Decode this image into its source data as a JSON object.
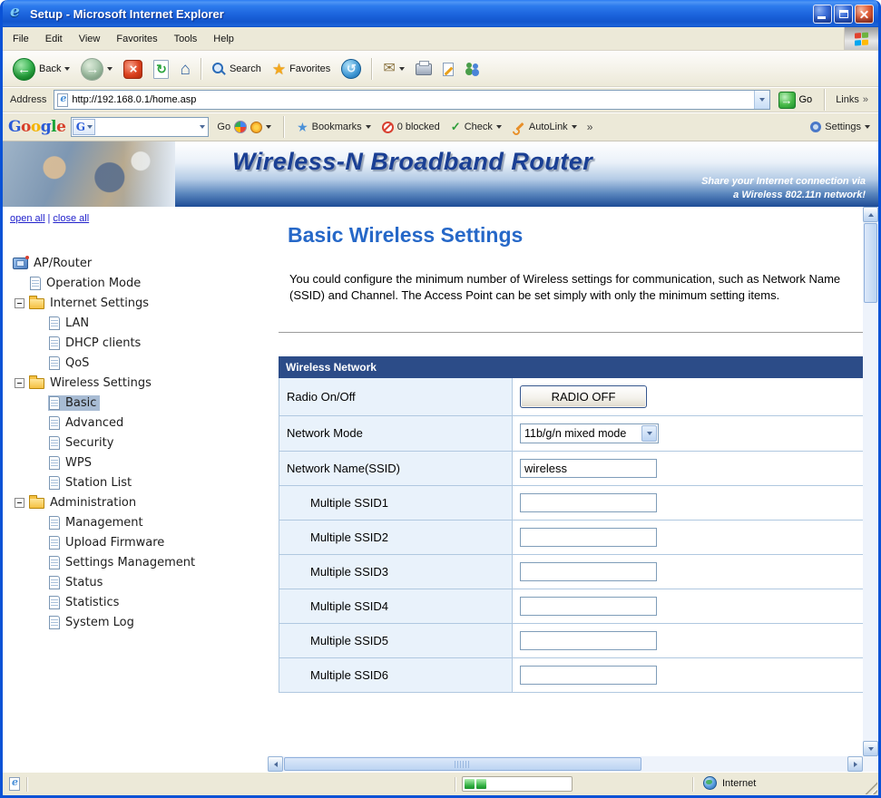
{
  "window": {
    "title": "Setup - Microsoft Internet Explorer"
  },
  "menu_bar": {
    "items": [
      "File",
      "Edit",
      "View",
      "Favorites",
      "Tools",
      "Help"
    ]
  },
  "toolbar": {
    "back": "Back",
    "search": "Search",
    "favorites": "Favorites"
  },
  "address_bar": {
    "label": "Address",
    "url": "http://192.168.0.1/home.asp",
    "go": "Go",
    "links": "Links",
    "chevron": "»"
  },
  "google_bar": {
    "logo": [
      "G",
      "o",
      "o",
      "g",
      "l",
      "e"
    ],
    "search_value": "",
    "go": "Go",
    "bookmarks": "Bookmarks",
    "blocked": "0 blocked",
    "check": "Check",
    "autolink": "AutoLink",
    "overflow": "»",
    "settings": "Settings"
  },
  "banner": {
    "title": "Wireless-N Broadband Router",
    "tagline1": "Share your Internet connection via",
    "tagline2": "a Wireless 802.11n network!"
  },
  "sidebar": {
    "open_all": "open all",
    "divider": "|",
    "close_all": "close all",
    "tree": [
      {
        "label": "AP/Router"
      },
      {
        "label": "Operation Mode"
      },
      {
        "label": "Internet Settings"
      },
      {
        "label": "LAN"
      },
      {
        "label": "DHCP clients"
      },
      {
        "label": "QoS"
      },
      {
        "label": "Wireless Settings"
      },
      {
        "label": "Basic"
      },
      {
        "label": "Advanced"
      },
      {
        "label": "Security"
      },
      {
        "label": "WPS"
      },
      {
        "label": "Station List"
      },
      {
        "label": "Administration"
      },
      {
        "label": "Management"
      },
      {
        "label": "Upload Firmware"
      },
      {
        "label": "Settings Management"
      },
      {
        "label": "Status"
      },
      {
        "label": "Statistics"
      },
      {
        "label": "System Log"
      }
    ]
  },
  "content": {
    "heading": "Basic Wireless Settings",
    "description": "You could configure the minimum number of Wireless settings for communication, such as Network Name (SSID) and Channel. The Access Point can be set simply with only the minimum setting items.",
    "table": {
      "header": "Wireless Network",
      "rows": [
        {
          "label": "Radio On/Off",
          "value": "RADIO OFF"
        },
        {
          "label": "Network Mode",
          "value": "11b/g/n mixed mode"
        },
        {
          "label": "Network Name(SSID)",
          "value": "wireless"
        },
        {
          "label": "Multiple SSID1",
          "value": ""
        },
        {
          "label": "Multiple SSID2",
          "value": ""
        },
        {
          "label": "Multiple SSID3",
          "value": ""
        },
        {
          "label": "Multiple SSID4",
          "value": ""
        },
        {
          "label": "Multiple SSID5",
          "value": ""
        },
        {
          "label": "Multiple SSID6",
          "value": ""
        }
      ]
    }
  },
  "status_bar": {
    "zone": "Internet"
  },
  "colors": {
    "titlebar_blue": "#1b5cd7",
    "heading_blue": "#2668c8",
    "table_header_bg": "#2c4c88",
    "row_label_bg": "#e9f2fb",
    "selected_tree_item": "#a8bcd4",
    "xp_face": "#ece9d8"
  }
}
